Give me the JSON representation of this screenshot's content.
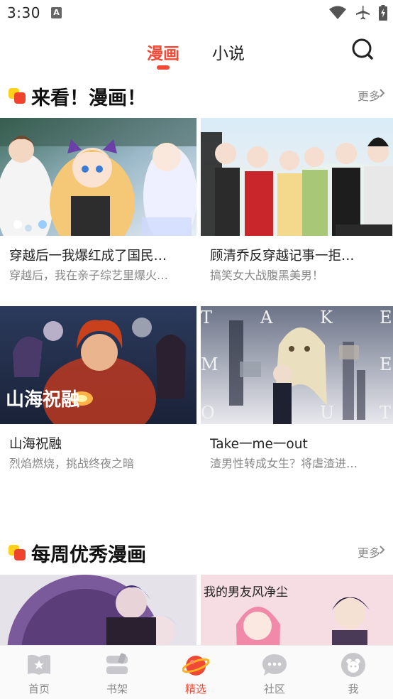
{
  "status_bar": {
    "time": "3:30",
    "notification_icon": "A"
  },
  "top_tabs": {
    "active": "漫画",
    "inactive": "小说"
  },
  "section1": {
    "title": "来看！漫画！",
    "more": "更多",
    "cards": [
      {
        "title": "穿越后一我爆红成了国民…",
        "subtitle": "穿越后，我在亲子综艺里爆火…"
      },
      {
        "title": "顾清乔反穿越记事一拒…",
        "subtitle": "搞笑女大战腹黑美男！"
      },
      {
        "title": "山海祝融",
        "subtitle": "烈焰燃烧，挑战终夜之暗",
        "cover_text": "山海祝融"
      },
      {
        "title": "Take一me一out",
        "subtitle": "渣男性转成女生？将虐渣进…",
        "cover_letters": [
          "T",
          "A",
          "K",
          "E",
          "M",
          "E",
          "O",
          "U",
          "T"
        ]
      }
    ]
  },
  "section2": {
    "title": "每周优秀漫画",
    "more": "更多",
    "cards": [
      {
        "cover_text": ""
      },
      {
        "cover_text": "我的男友风净尘"
      }
    ]
  },
  "bottom_nav": {
    "items": [
      {
        "label": "首页",
        "icon": "book-star-icon"
      },
      {
        "label": "书架",
        "icon": "bookshelf-icon"
      },
      {
        "label": "精选",
        "icon": "planet-icon"
      },
      {
        "label": "社区",
        "icon": "chat-bubble-icon"
      },
      {
        "label": "我",
        "icon": "profile-face-icon"
      }
    ],
    "active_index": 2
  },
  "colors": {
    "accent": "#f04a36",
    "yellow": "#ffd11a",
    "muted": "#888888"
  }
}
